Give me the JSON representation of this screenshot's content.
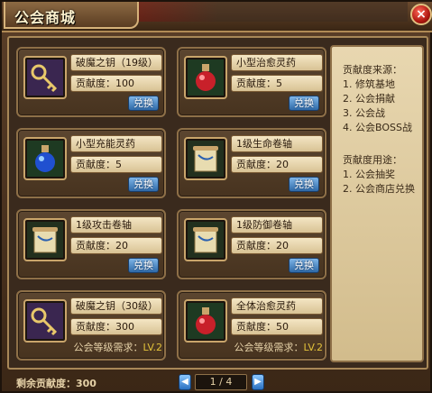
{
  "window": {
    "title": "公会商城",
    "close_symbol": "×"
  },
  "items": [
    {
      "name": "破魔之钥（19级）",
      "contrib_label": "贡献度：",
      "contrib_value": "100",
      "icon": "key-icon",
      "button": "兑换"
    },
    {
      "name": "小型治愈灵药",
      "contrib_label": "贡献度：",
      "contrib_value": "5",
      "icon": "red-potion-icon",
      "button": "兑换"
    },
    {
      "name": "小型充能灵药",
      "contrib_label": "贡献度：",
      "contrib_value": "5",
      "icon": "blue-potion-icon",
      "button": "兑换"
    },
    {
      "name": "1级生命卷轴",
      "contrib_label": "贡献度：",
      "contrib_value": "20",
      "icon": "scroll-icon",
      "button": "兑换"
    },
    {
      "name": "1级攻击卷轴",
      "contrib_label": "贡献度：",
      "contrib_value": "20",
      "icon": "scroll-icon",
      "button": "兑换"
    },
    {
      "name": "1级防御卷轴",
      "contrib_label": "贡献度：",
      "contrib_value": "20",
      "icon": "scroll-icon",
      "button": "兑换"
    },
    {
      "name": "破魔之钥（30级）",
      "contrib_label": "贡献度：",
      "contrib_value": "300",
      "icon": "key-icon",
      "req_label": "公会等级需求：",
      "req_value": "LV.2"
    },
    {
      "name": "全体治愈灵药",
      "contrib_label": "贡献度：",
      "contrib_value": "50",
      "icon": "red-potion-icon",
      "req_label": "公会等级需求：",
      "req_value": "LV.2"
    }
  ],
  "info": {
    "source_title": "贡献度来源：",
    "sources": [
      "1. 修筑基地",
      "2. 公会捐献",
      "3. 公会战",
      "4. 公会BOSS战"
    ],
    "usage_title": "贡献度用途：",
    "usages": [
      "1. 公会抽奖",
      "2. 公会商店兑换"
    ]
  },
  "footer": {
    "remaining_label": "剩余贡献度：",
    "remaining_value": "300",
    "page_current": "1",
    "page_total": "4",
    "page_text": "1 / 4",
    "prev_symbol": "◀",
    "next_symbol": "▶"
  },
  "colors": {
    "level_requirement": "#e2c23a",
    "exchange_button": "#2f6aa8",
    "close_button": "#b01810"
  }
}
